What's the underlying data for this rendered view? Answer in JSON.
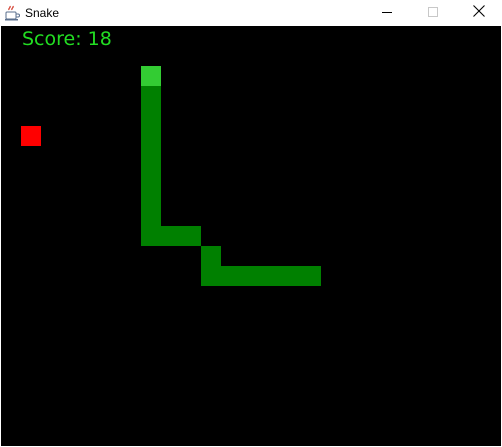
{
  "window": {
    "title": "Snake",
    "icon": "java-cup-icon",
    "controls": [
      "minimize-icon",
      "maximize-icon",
      "close-icon"
    ]
  },
  "game": {
    "score_text": "Score: 18",
    "score": 18,
    "colors": {
      "background": "#000000",
      "score_text": "#22dd22",
      "snake_head": "#33cc33",
      "snake_body": "#008000",
      "food": "#ff0000"
    },
    "snake_cells": [
      [
        7,
        2
      ],
      [
        7,
        3
      ],
      [
        7,
        4
      ],
      [
        7,
        5
      ],
      [
        7,
        6
      ],
      [
        7,
        7
      ],
      [
        7,
        8
      ],
      [
        7,
        9
      ],
      [
        7,
        10
      ],
      [
        8,
        10
      ],
      [
        9,
        10
      ],
      [
        10,
        11
      ],
      [
        10,
        12
      ],
      [
        11,
        12
      ],
      [
        12,
        12
      ],
      [
        13,
        12
      ],
      [
        14,
        12
      ],
      [
        15,
        12
      ]
    ],
    "food_cell": [
      1,
      5
    ]
  }
}
